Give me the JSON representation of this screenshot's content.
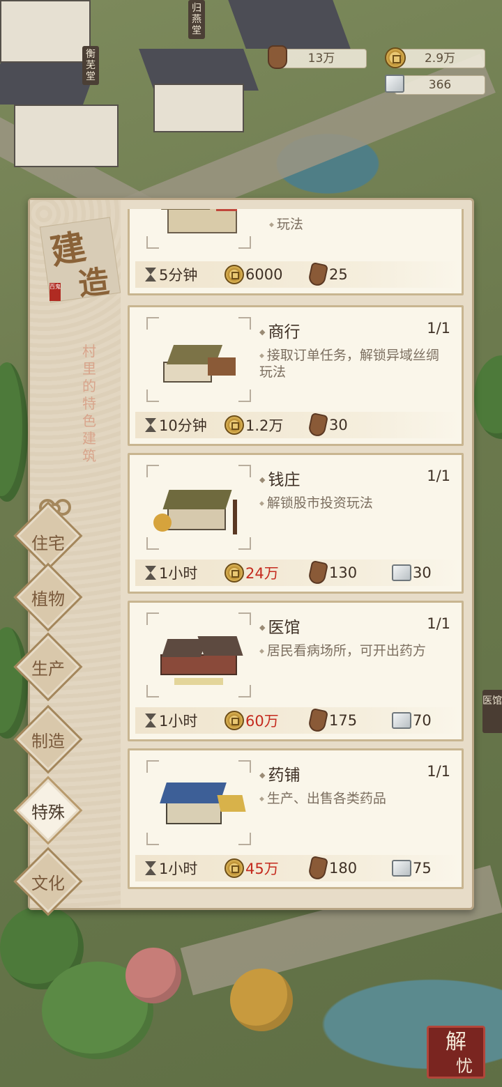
{
  "resources": {
    "wood": {
      "icon": "wood-log-icon",
      "value": "13万"
    },
    "coin": {
      "icon": "copper-coin-icon",
      "value": "2.9万"
    },
    "stone": {
      "icon": "stone-block-icon",
      "value": "366"
    }
  },
  "map_signs": {
    "sign_1": "衡芜堂",
    "sign_2": "归燕堂",
    "side": "医馆"
  },
  "panel": {
    "title_chars": [
      "建",
      "造"
    ],
    "seal_text": "百鬼",
    "subtitle": "村里的特色建筑"
  },
  "categories": [
    {
      "label": "住宅",
      "active": false
    },
    {
      "label": "植物",
      "active": false
    },
    {
      "label": "生产",
      "active": false
    },
    {
      "label": "制造",
      "active": false
    },
    {
      "label": "特殊",
      "active": true
    },
    {
      "label": "文化",
      "active": false
    }
  ],
  "buildings": [
    {
      "name": "",
      "count": "",
      "desc": "玩法",
      "time": "5分钟",
      "coin": "6000",
      "coin_red": false,
      "wood": "25",
      "stone": null
    },
    {
      "name": "商行",
      "count": "1/1",
      "desc": "接取订单任务，解锁异域丝绸玩法",
      "time": "10分钟",
      "coin": "1.2万",
      "coin_red": false,
      "wood": "30",
      "stone": null
    },
    {
      "name": "钱庄",
      "count": "1/1",
      "desc": "解锁股市投资玩法",
      "time": "1小时",
      "coin": "24万",
      "coin_red": true,
      "wood": "130",
      "stone": "30"
    },
    {
      "name": "医馆",
      "count": "1/1",
      "desc": "居民看病场所，可开出药方",
      "time": "1小时",
      "coin": "60万",
      "coin_red": true,
      "wood": "175",
      "stone": "70"
    },
    {
      "name": "药铺",
      "count": "1/1",
      "desc": "生产、出售各类药品",
      "time": "1小时",
      "coin": "45万",
      "coin_red": true,
      "wood": "180",
      "stone": "75"
    }
  ],
  "stamp": [
    "解",
    "忧"
  ],
  "colors": {
    "panel_bg": "#e7dcc8",
    "card_bg": "#faf6ea",
    "cost_red": "#c42a1e",
    "accent_brown": "#a4875c"
  }
}
